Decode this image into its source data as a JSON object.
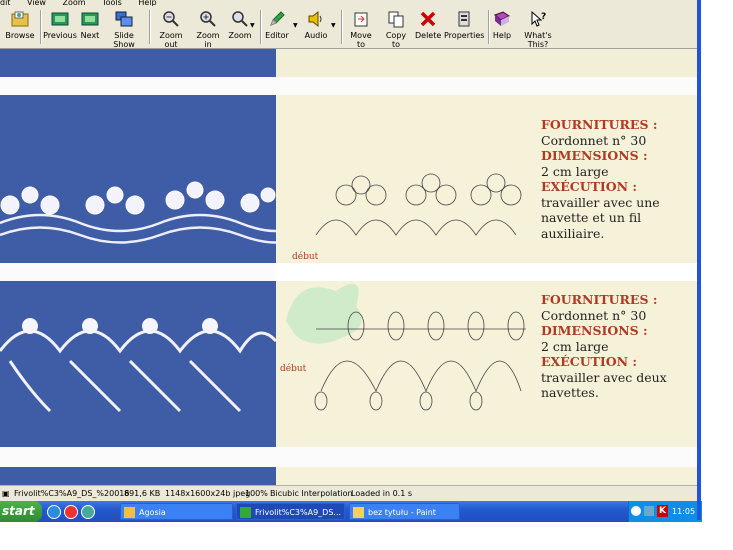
{
  "menu": [
    "dit",
    "View",
    "Zoom",
    "Tools",
    "Help"
  ],
  "toolbar": {
    "browse": "Browse",
    "previous": "Previous",
    "next": "Next",
    "slideshow": "Slide Show",
    "zoom_out": "Zoom out",
    "zoom_in": "Zoom in",
    "zoom": "Zoom",
    "editor": "Editor",
    "audio": "Audio",
    "move_to": "Move to",
    "copy_to": "Copy to",
    "delete": "Delete",
    "properties": "Properties",
    "help": "Help",
    "whats_this": "What's This?"
  },
  "pattern1": {
    "label_debut": "début",
    "fournitures": "FOURNITURES :",
    "fournitures_val": "Cordonnet n° 30",
    "dimensions": "DIMENSIONS :",
    "dimensions_val": "2 cm large",
    "execution": "EXÉCUTION :",
    "execution_val_lines": [
      "travailler avec une",
      "navette et un fil",
      "auxiliaire."
    ]
  },
  "pattern2": {
    "label_debut": "début",
    "fournitures": "FOURNITURES :",
    "fournitures_val": "Cordonnet n° 30",
    "dimensions": "DIMENSIONS :",
    "dimensions_val": "2 cm large",
    "execution": "EXÉCUTION :",
    "execution_val_lines": [
      "travailler avec deux",
      "navettes."
    ]
  },
  "status": {
    "filename": "Frivolit%C3%A9_DS_%20016",
    "size": "891,6 KB",
    "dims": "1148x1600x24b jpeg",
    "zoom": "100%",
    "interp": "Bicubic Interpolation",
    "loaded": "Loaded in 0.1 s"
  },
  "taskbar": {
    "start": "start",
    "tasks": [
      "Agosia",
      "Frivolit%C3%A9_DS...",
      "bez tytułu - Paint"
    ],
    "clock": "11:05"
  }
}
